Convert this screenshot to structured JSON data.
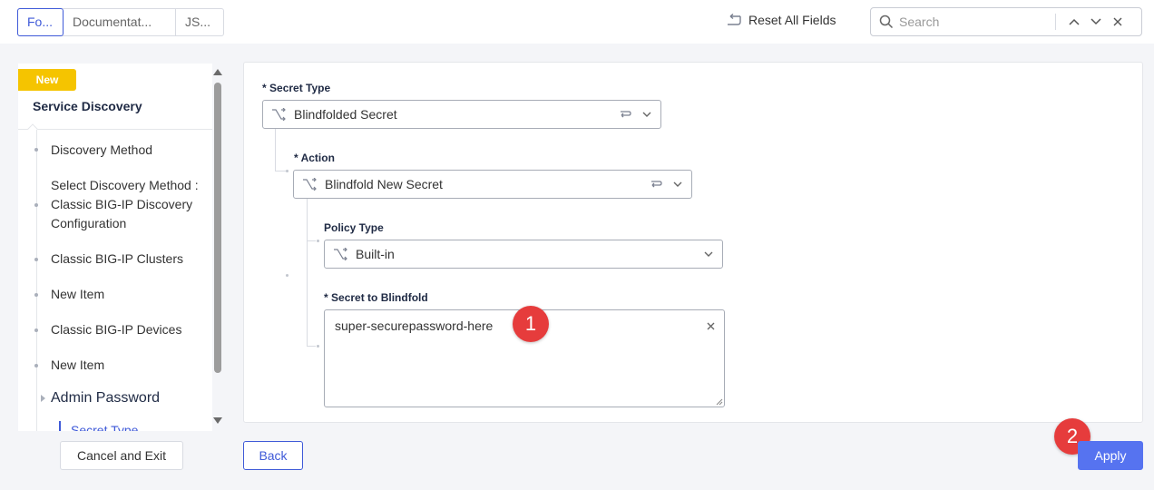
{
  "header": {
    "tabs": [
      {
        "label": "Fo...",
        "active": true
      },
      {
        "label": "Documentat...",
        "active": false
      },
      {
        "label": "JS...",
        "active": false
      }
    ],
    "reset_label": "Reset All Fields",
    "search": {
      "placeholder": "Search",
      "value": ""
    }
  },
  "sidebar": {
    "badge": "New",
    "title": "Service Discovery",
    "items": [
      {
        "label": "Discovery Method"
      },
      {
        "label": "Select Discovery Method : Classic BIG-IP Discovery Configuration"
      },
      {
        "label": "Classic BIG-IP Clusters"
      },
      {
        "label": "New Item"
      },
      {
        "label": "Classic BIG-IP Devices"
      },
      {
        "label": "New Item"
      }
    ],
    "section": "Admin Password",
    "sub_item": "Secret Type"
  },
  "form": {
    "secret_type": {
      "required": "*",
      "label": "Secret Type",
      "value": "Blindfolded Secret"
    },
    "action": {
      "required": "*",
      "label": "Action",
      "value": "Blindfold New Secret"
    },
    "policy_type": {
      "label": "Policy Type",
      "value": "Built-in"
    },
    "secret": {
      "required": "*",
      "label": "Secret to Blindfold",
      "value": "super-securepassword-here"
    }
  },
  "markers": [
    "1",
    "2"
  ],
  "buttons": {
    "cancel": "Cancel and Exit",
    "back": "Back",
    "apply": "Apply"
  },
  "colors": {
    "accent": "#3f5ad8",
    "apply": "#5673f0",
    "badge": "#f5c400",
    "marker": "#e63c3c"
  }
}
